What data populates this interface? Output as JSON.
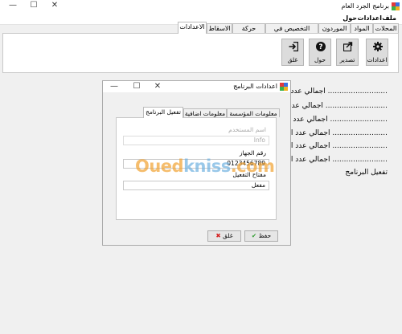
{
  "app": {
    "title": "برنامج الجرد العام"
  },
  "window_controls": {
    "minimize": "—",
    "maximize": "☐",
    "close": "✕"
  },
  "menu": {
    "items": [
      "ملف",
      "اعدادات",
      "حول"
    ]
  },
  "tabs": [
    {
      "label": "المحلات"
    },
    {
      "label": "المواد"
    },
    {
      "label": "الموردون"
    },
    {
      "label": "التخصيص في المحلات"
    },
    {
      "label": "حركة المواد"
    },
    {
      "label": "الاسقاط"
    },
    {
      "label": "الاعدادات",
      "active": true
    }
  ],
  "ribbon": {
    "buttons": [
      {
        "label": "اعدادات",
        "icon": "gear-icon"
      },
      {
        "label": "تصدير",
        "icon": "export-icon"
      },
      {
        "label": "حول",
        "icon": "help-icon"
      },
      {
        "label": "غلق",
        "icon": "exit-icon"
      }
    ]
  },
  "summary": {
    "items": [
      "اجمالي عدد المحلات ..........................",
      "اجمالي عدد المواد ...........................",
      "اجمالي عدد الموردين .........................",
      "اجمالي عدد التخصيصات ........................",
      "اجمالي عدد التحويلات ........................",
      "اجمالي عدد الاسقاطات ........................",
      "تفعيل البرنامج"
    ]
  },
  "dialog": {
    "title": "اعدادات البرنامج",
    "controls": {
      "minimize": "—",
      "maximize": "☐",
      "close": "✕"
    },
    "tabs": [
      {
        "label": "معلومات المؤسسة"
      },
      {
        "label": "معلومات اضافية"
      },
      {
        "label": "تفعيل البرنامج",
        "active": true
      }
    ],
    "fields": {
      "username_label": "اسم المستخدم",
      "username_value": "Info",
      "device_label": "رقم الجهاز",
      "device_value": "0123456789",
      "key_label": "مفتاح التفعيل",
      "key_value": "مفعل"
    },
    "buttons": {
      "save": "حفظ",
      "close": "غلق"
    }
  },
  "watermark": {
    "text_part1": "Oued",
    "text_part2": "kniss",
    "text_part3": ".com"
  },
  "colors": {
    "accent": "#0078d7",
    "save_check": "#2e9c2e",
    "close_x": "#d42020",
    "watermark_orange": "#f2a230"
  }
}
